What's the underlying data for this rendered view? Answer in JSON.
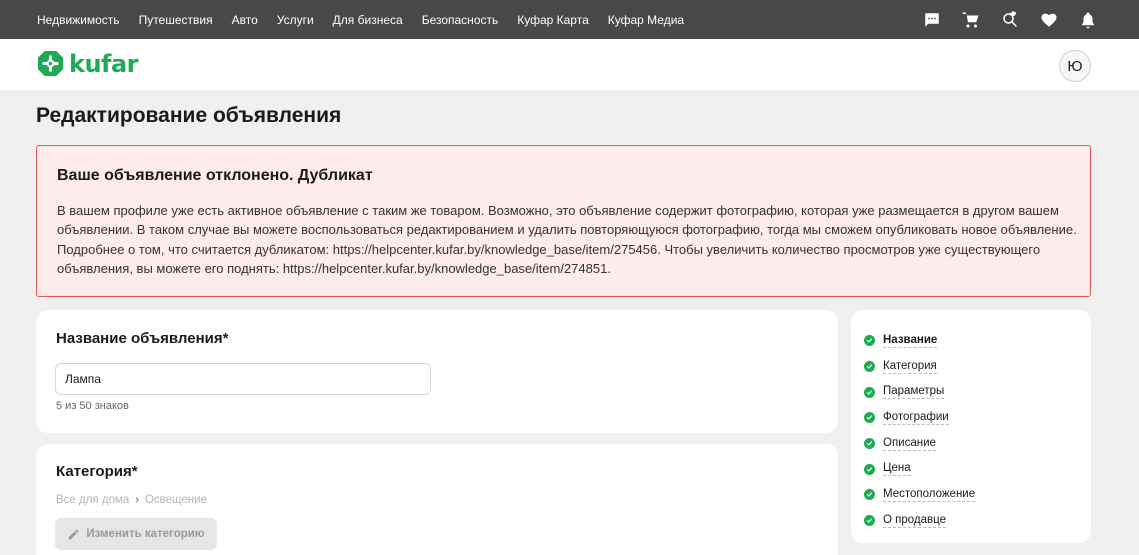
{
  "topnav": [
    {
      "label": "Недвижимость"
    },
    {
      "label": "Путешествия"
    },
    {
      "label": "Авто"
    },
    {
      "label": "Услуги"
    },
    {
      "label": "Для бизнеса"
    },
    {
      "label": "Безопасность"
    },
    {
      "label": "Куфар Карта"
    },
    {
      "label": "Куфар Медиа"
    }
  ],
  "topicons": [
    "chat-icon",
    "cart-icon",
    "search-heart-icon",
    "heart-icon",
    "bell-icon"
  ],
  "header": {
    "logo_text": "kufar",
    "avatar_initial": "Ю",
    "brand_color": "#1fab55"
  },
  "page_title": "Редактирование объявления",
  "alert": {
    "title": "Ваше объявление отклонено. Дубликат",
    "text": "В вашем профиле уже есть активное объявление с таким же товаром. Возможно, это объявление содержит фотографию, которая уже размещается в другом вашем объявлении. В таком случае вы можете воспользоваться редактированием и удалить повторяющуюся фотографию, тогда мы сможем опубликовать новое объявление. Подробнее о том, что считается дубликатом: https://helpcenter.kufar.by/knowledge_base/item/275456. Чтобы увеличить количество просмотров уже существующего объявления, вы можете его поднять: https://helpcenter.kufar.by/knowledge_base/item/274851.",
    "border_color": "#e05a5a",
    "background_color": "#fdeceb"
  },
  "name_section": {
    "title": "Название объявления*",
    "value": "Лампа",
    "counter": "5 из 50 знаков"
  },
  "category_section": {
    "title": "Категория*",
    "crumbs": [
      "Все для дома",
      "Освещение"
    ],
    "separator": "›",
    "change_button": "Изменить категорию"
  },
  "steps": [
    {
      "label": "Название",
      "active": true
    },
    {
      "label": "Категория"
    },
    {
      "label": "Параметры"
    },
    {
      "label": "Фотографии"
    },
    {
      "label": "Описание"
    },
    {
      "label": "Цена"
    },
    {
      "label": "Местоположение"
    },
    {
      "label": "О продавце"
    }
  ]
}
